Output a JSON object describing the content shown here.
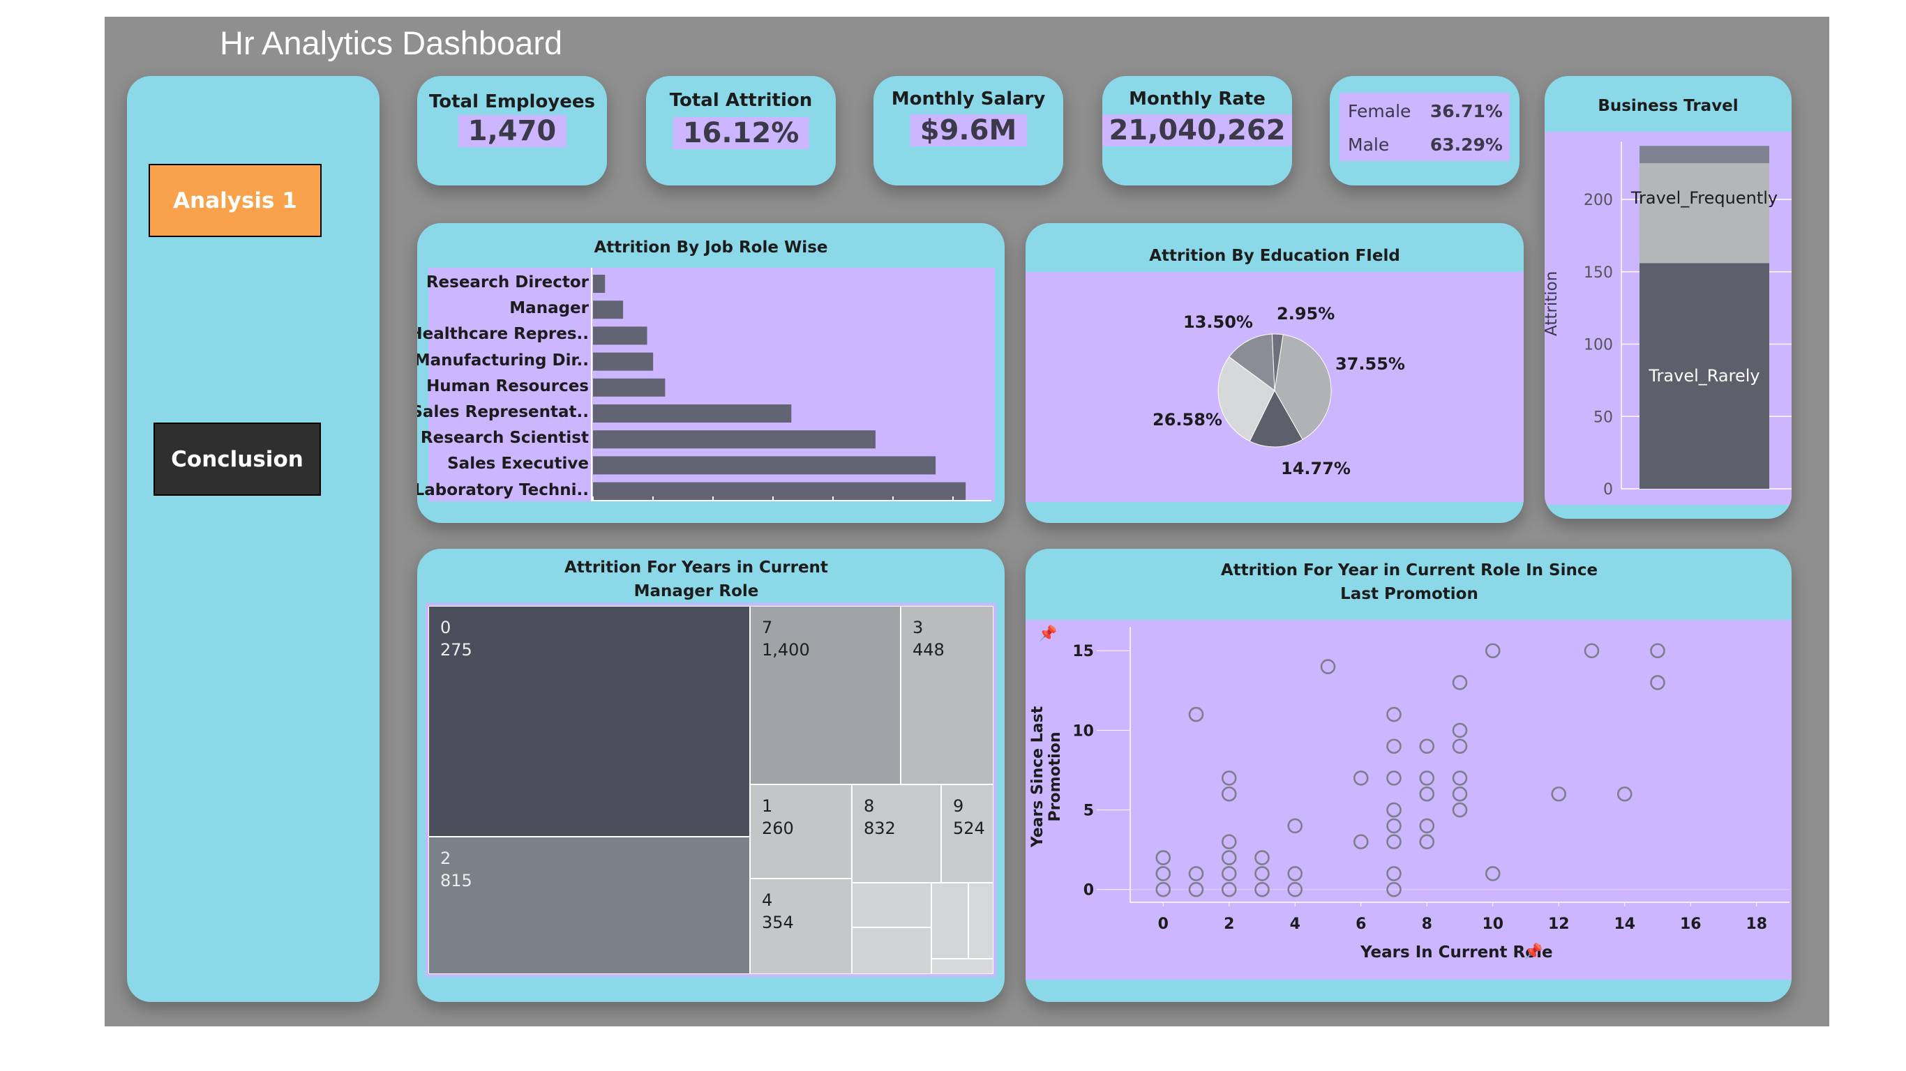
{
  "app": {
    "title": "Hr Analytics Dashboard"
  },
  "nav": {
    "analysis_label": "Analysis 1",
    "conclusion_label": "Conclusion"
  },
  "kpis": {
    "total_employees": {
      "label": "Total Employees",
      "value": "1,470"
    },
    "total_attrition": {
      "label": "Total Attrition",
      "value": "16.12%"
    },
    "monthly_salary": {
      "label": "Monthly Salary",
      "value": "$9.6M"
    },
    "monthly_rate": {
      "label": "Monthly Rate",
      "value": "21,040,262"
    },
    "gender": {
      "female_label": "Female",
      "female_value": "36.71%",
      "male_label": "Male",
      "male_value": "63.29%"
    }
  },
  "colors": {
    "panel": "#8ad8e8",
    "plot_bg": "#cbb6ff",
    "canvas": "#8f8f8f",
    "analysis_button": "#f9a24b",
    "conclusion_button": "#2f2f2f"
  },
  "chart_data": [
    {
      "id": "job_role",
      "type": "bar",
      "orientation": "horizontal",
      "title": "Attrition By Job Role Wise",
      "categories": [
        "Research Director",
        "Manager",
        "Healthcare Repres..",
        "Manufacturing Dir..",
        "Human Resources",
        "Sales Representat..",
        "Research Scientist",
        "Sales Executive",
        "Laboratory Techni.."
      ],
      "values": [
        2,
        5,
        9,
        10,
        12,
        33,
        47,
        57,
        62
      ],
      "xlim": [
        0,
        65
      ],
      "grid": false
    },
    {
      "id": "education_field",
      "type": "pie",
      "title": "Attrition By Education FIeld",
      "values": [
        37.55,
        14.77,
        26.58,
        13.5,
        2.95
      ],
      "labels": [
        "37.55%",
        "14.77%",
        "26.58%",
        "13.50%",
        "2.95%"
      ],
      "colors": [
        "#b0b2b6",
        "#5d5f6b",
        "#d7d8da",
        "#8a8c96",
        "#6e707c"
      ]
    },
    {
      "id": "business_travel",
      "type": "bar",
      "stacked": true,
      "title": "Business Travel",
      "ylabel": "Attrition",
      "yticks": [
        "0",
        "50",
        "100",
        "150",
        "200"
      ],
      "ylim": [
        0,
        240
      ],
      "series": [
        {
          "name": "Travel_Rarely",
          "value": 156,
          "color": "#5d5f6b"
        },
        {
          "name": "Travel_Frequently",
          "value": 69,
          "color": "#b4b6b8"
        },
        {
          "name": "",
          "value": 12,
          "color": "#7f8290"
        }
      ]
    },
    {
      "id": "years_manager",
      "type": "treemap",
      "title": "Attrition For Years in Current Manager Role",
      "items": [
        {
          "label": "0",
          "value": "275",
          "color": "#4a4f5b",
          "text_color": "#eeeeee"
        },
        {
          "label": "2",
          "value": "815",
          "color": "#7a8188",
          "text_color": "#eeeeee"
        },
        {
          "label": "7",
          "value": "1,400",
          "color": "#a0a4a6",
          "text_color": "#1e1e1e"
        },
        {
          "label": "3",
          "value": "448",
          "color": "#b9bbbd",
          "text_color": "#1e1e1e"
        },
        {
          "label": "1",
          "value": "260",
          "color": "#c3c5c6",
          "text_color": "#1e1e1e"
        },
        {
          "label": "8",
          "value": "832",
          "color": "#c7c9ca",
          "text_color": "#1e1e1e"
        },
        {
          "label": "9",
          "value": "524",
          "color": "#c9cbcc",
          "text_color": "#1e1e1e"
        },
        {
          "label": "4",
          "value": "354",
          "color": "#c5c7c8",
          "text_color": "#1e1e1e"
        }
      ]
    },
    {
      "id": "promotion_scatter",
      "type": "scatter",
      "title": "Attrition For Year in Current Role In Since Last Promotion",
      "xlabel": "Years In Current Role",
      "ylabel": "Years Since Last Promotion",
      "xticks": [
        "0",
        "2",
        "4",
        "6",
        "8",
        "10",
        "12",
        "14",
        "16",
        "18"
      ],
      "yticks": [
        "0",
        "5",
        "10",
        "15"
      ],
      "xlim": [
        -1,
        19
      ],
      "ylim": [
        -0.8,
        16.5
      ],
      "points": [
        [
          0,
          0
        ],
        [
          0,
          1
        ],
        [
          0,
          2
        ],
        [
          1,
          0
        ],
        [
          1,
          1
        ],
        [
          1,
          11
        ],
        [
          2,
          0
        ],
        [
          2,
          1
        ],
        [
          2,
          2
        ],
        [
          2,
          3
        ],
        [
          2,
          6
        ],
        [
          2,
          7
        ],
        [
          3,
          0
        ],
        [
          3,
          1
        ],
        [
          3,
          2
        ],
        [
          4,
          0
        ],
        [
          4,
          1
        ],
        [
          4,
          4
        ],
        [
          5,
          14
        ],
        [
          6,
          3
        ],
        [
          6,
          7
        ],
        [
          7,
          0
        ],
        [
          7,
          1
        ],
        [
          7,
          3
        ],
        [
          7,
          4
        ],
        [
          7,
          5
        ],
        [
          7,
          7
        ],
        [
          7,
          9
        ],
        [
          7,
          11
        ],
        [
          8,
          3
        ],
        [
          8,
          4
        ],
        [
          8,
          6
        ],
        [
          8,
          7
        ],
        [
          8,
          9
        ],
        [
          9,
          5
        ],
        [
          9,
          6
        ],
        [
          9,
          7
        ],
        [
          9,
          9
        ],
        [
          9,
          10
        ],
        [
          9,
          13
        ],
        [
          10,
          1
        ],
        [
          10,
          15
        ],
        [
          12,
          6
        ],
        [
          13,
          15
        ],
        [
          14,
          6
        ],
        [
          15,
          13
        ],
        [
          15,
          15
        ]
      ]
    }
  ]
}
